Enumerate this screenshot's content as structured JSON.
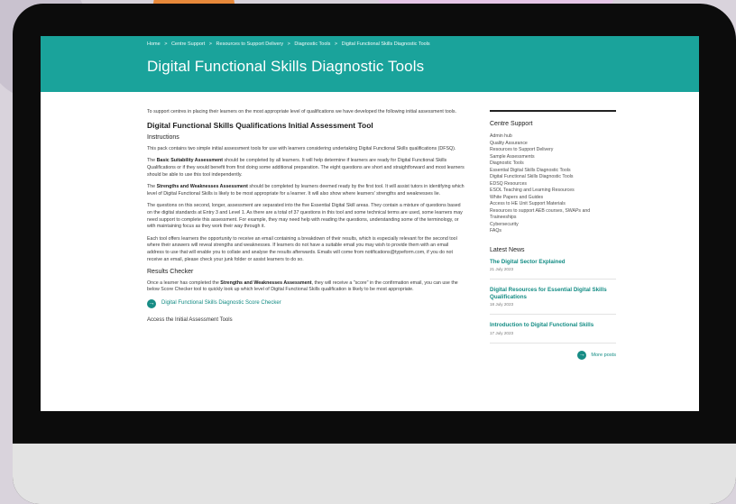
{
  "breadcrumb": [
    "Home",
    ">",
    "Centre Support",
    ">",
    "Resources to Support Delivery",
    ">",
    "Diagnostic Tools",
    ">",
    "Digital Functional Skills Diagnostic Tools"
  ],
  "page_title": "Digital Functional Skills Diagnostic Tools",
  "main": {
    "intro": "To support centres in placing their learners on the most appropriate level of qualifications we have developed the following initial assessment tools.",
    "section_heading": "Digital Functional Skills Qualifications Initial Assessment Tool",
    "instructions_heading": "Instructions",
    "p1": "This pack contains two simple initial assessment tools for use with learners considering undertaking Digital Functional Skills qualifications (DFSQ).",
    "p2_bold": "Basic Suitability Assessment",
    "p2_pre": "The ",
    "p2_post": " should be completed by all learners. It will help determine if learners are ready for Digital Functional Skills Qualifications or if they would benefit from first doing some additional preparation. The eight questions are short and straightforward and most learners should be able to use this tool independently.",
    "p3_pre": "The ",
    "p3_bold": "Strengths and Weaknesses Assessment",
    "p3_post": " should be completed by learners deemed ready by the first tool. It will assist tutors in identifying which level of Digital Functional Skills is likely to be most appropriate for a learner. It will also show where learners' strengths and weaknesses lie.",
    "p4": "The questions on this second, longer, assessment are separated into the five Essential Digital Skill areas. They contain a mixture of questions based on the digital standards at Entry 3 and Level 1. As there are a total of 37 questions in this tool and some technical terms are used, some learners may need support to complete this assessment. For example, they may need help with reading the questions, understanding some of the terminology, or with maintaining focus as they work their way through it.",
    "p5": "Each tool offers learners the opportunity to receive an email containing a breakdown of their results, which is especially relevant for the second tool where their answers will reveal strengths and weaknesses. If learners do not have a suitable email you may wish to provide them with an email address to use that will enable you to collate and analyse the results afterwards. Emails will come from notifications@typeform.com, if you do not receive an email, please check your junk folder or assist learners to do so.",
    "results_heading": "Results Checker",
    "p6_pre": "Once a learner has completed the ",
    "p6_bold": "Strengths and Weaknesses Assessment",
    "p6_post": ", they will receive a \"score\" in the confirmation email, you can use the below Score Checker tool to quickly look up which level of Digital Functional Skills qualification is likely to be most appropriate.",
    "score_link": "Digital Functional Skills Diagnostic Score Checker",
    "cutoff_heading": "Access the Initial Assessment Tools"
  },
  "sidebar": {
    "title": "Centre Support",
    "items": [
      "Admin hub",
      "Quality Assurance",
      "Resources to Support Delivery",
      "Sample Assessments",
      "Diagnostic Tools",
      "Essential Digital Skills Diagnostic Tools",
      "Digital Functional Skills Diagnostic Tools",
      "EDSQ Resources",
      "ESOL Teaching and Learning Resources",
      "White Papers and Guides",
      "Access to HE Unit Support Materials",
      "Resources to support AEB courses, SWAPs and Traineeships",
      "Cybersecurity",
      "FAQs"
    ],
    "news_title": "Latest News",
    "news": [
      {
        "title": "The Digital Sector Explained",
        "date": "21 July 2023"
      },
      {
        "title": "Digital Resources for Essential Digital Skills Qualifications",
        "date": "18 July 2023"
      },
      {
        "title": "Introduction to Digital Functional Skills",
        "date": "17 July 2023"
      }
    ],
    "more_posts": "More posts"
  },
  "icons": {
    "arrow": "→"
  },
  "colors": {
    "accent": "#1aa39b",
    "link": "#138c84"
  }
}
